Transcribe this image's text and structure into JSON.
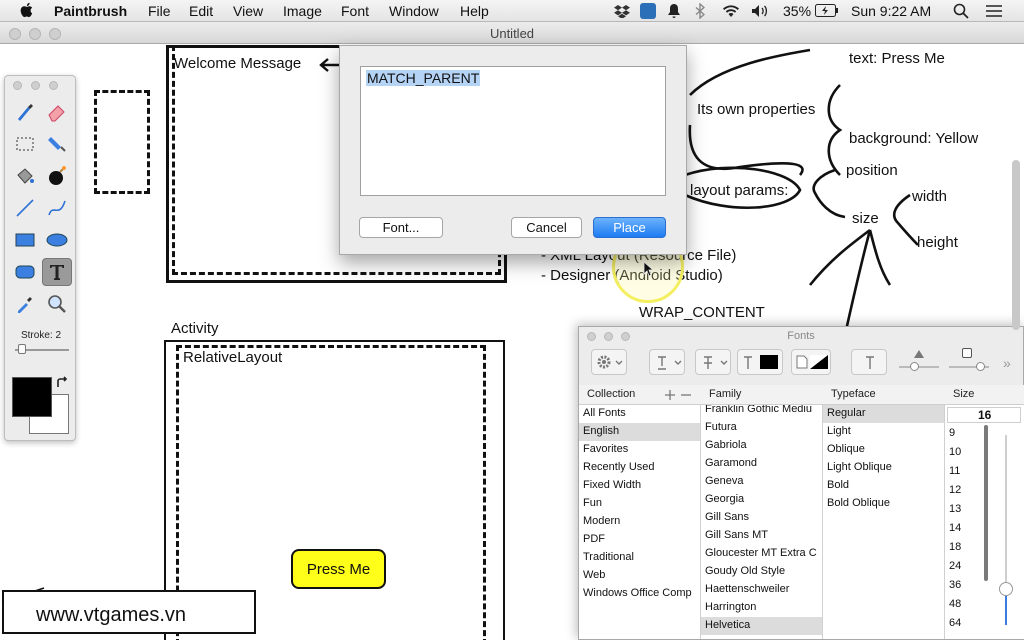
{
  "menubar": {
    "app_name": "Paintbrush",
    "items": [
      "File",
      "Edit",
      "View",
      "Image",
      "Font",
      "Window",
      "Help"
    ],
    "battery": "35%",
    "clock": "Sun 9:22 AM"
  },
  "window": {
    "title": "Untitled"
  },
  "canvas": {
    "welcome_label": "Welcome Message",
    "activity_label": "Activity",
    "relative_layout_label": "RelativeLayout",
    "press_me_label": "Press Me",
    "press_me_color": "#ffff1a",
    "own_properties": "Its own properties",
    "text_prop": "text: Press Me",
    "background_prop": "background: Yellow",
    "layout_params": "layout params:",
    "position": "position",
    "size": "size",
    "width": "width",
    "height": "height",
    "xml_layout": "- XML Layout (Resource File)",
    "designer": "- Designer (Android Studio)",
    "wrap_content": "WRAP_CONTENT"
  },
  "tools": {
    "stroke_label": "Stroke: 2",
    "stroke_value": 2,
    "items": [
      "brush-tool",
      "eraser-tool",
      "selection-tool",
      "fill-tool",
      "bucket-tool",
      "bomb-tool",
      "line-tool",
      "curve-tool",
      "rectangle-tool",
      "ellipse-tool",
      "rounded-rect-tool",
      "text-tool",
      "eyedropper-tool",
      "zoom-tool"
    ],
    "selected": "text-tool",
    "primary_color": "#000000",
    "secondary_color": "#ffffff"
  },
  "dialog": {
    "text_value": "MATCH_PARENT",
    "font_button": "Font...",
    "cancel_button": "Cancel",
    "place_button": "Place"
  },
  "fonts_panel": {
    "title": "Fonts",
    "headers": {
      "collection": "Collection",
      "family": "Family",
      "typeface": "Typeface",
      "size": "Size"
    },
    "collections": [
      "All Fonts",
      "English",
      "Favorites",
      "Recently Used",
      "Fixed Width",
      "Fun",
      "Modern",
      "PDF",
      "Traditional",
      "Web",
      "Windows Office Comp"
    ],
    "selected_collection": "English",
    "families": [
      "Franklin Gothic Mediu",
      "Futura",
      "Gabriola",
      "Garamond",
      "Geneva",
      "Georgia",
      "Gill Sans",
      "Gill Sans MT",
      "Gloucester MT Extra C",
      "Goudy Old Style",
      "Haettenschweiler",
      "Harrington",
      "Helvetica"
    ],
    "selected_family": "Helvetica",
    "typefaces": [
      "Regular",
      "Light",
      "Oblique",
      "Light Oblique",
      "Bold",
      "Bold Oblique"
    ],
    "selected_typeface": "Regular",
    "size_value": "16",
    "sizes": [
      "9",
      "10",
      "11",
      "12",
      "13",
      "14",
      "18",
      "24",
      "36",
      "48",
      "64"
    ]
  },
  "watermark": "www.vtgames.vn"
}
